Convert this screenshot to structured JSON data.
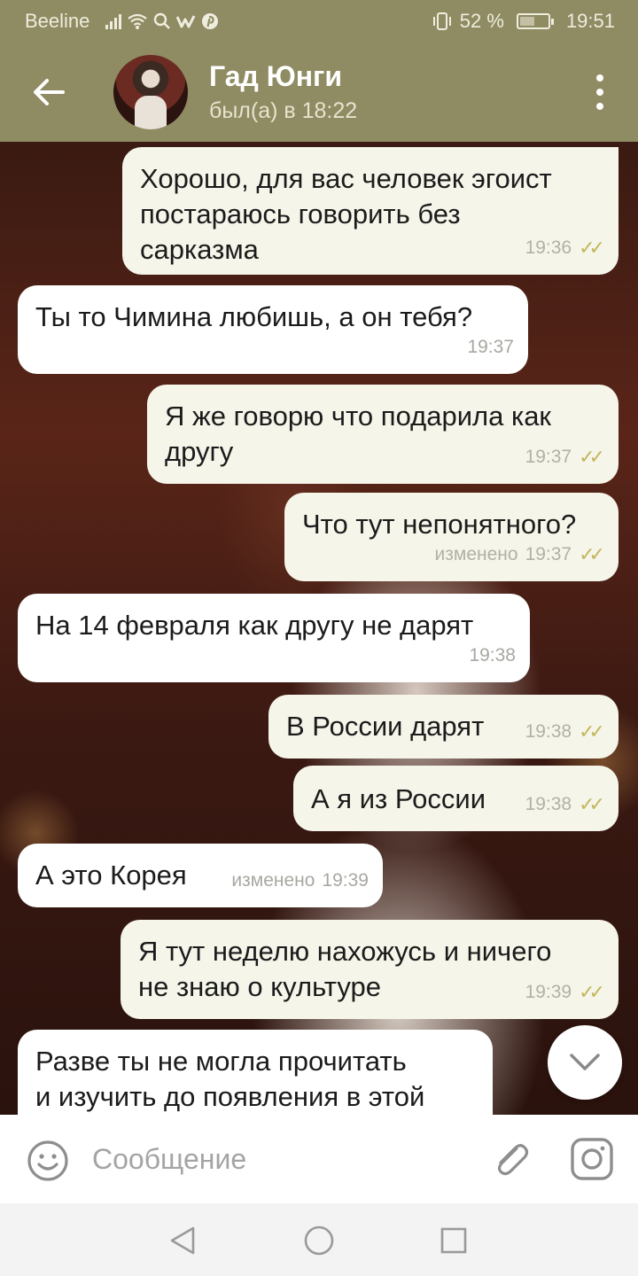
{
  "status_bar": {
    "carrier": "Beeline",
    "battery": "52 %",
    "time": "19:51",
    "battery_level": 0.52
  },
  "header": {
    "contact_name": "Гад Юнги",
    "contact_status": "был(а) в 18:22",
    "icons": [
      "back-arrow-icon",
      "avatar",
      "more-vert-icon"
    ]
  },
  "messages": [
    {
      "dir": "out",
      "text": "Хорошо, для вас человек эгоист\nпостараюсь говорить без\nсарказма",
      "time": "19:36",
      "edited": "",
      "read": true
    },
    {
      "dir": "in",
      "text": "Ты то Чимина любишь, а он тебя?",
      "time": "19:37",
      "edited": "",
      "read": false
    },
    {
      "dir": "out",
      "text": "Я же говорю что подарила как\nдругу",
      "time": "19:37",
      "edited": "",
      "read": true
    },
    {
      "dir": "out",
      "text": "Что тут непонятного?",
      "time": "19:37",
      "edited": "изменено",
      "read": true
    },
    {
      "dir": "in",
      "text": "На 14 февраля как другу не дарят",
      "time": "19:38",
      "edited": "",
      "read": false
    },
    {
      "dir": "out",
      "text": "В России дарят",
      "time": "19:38",
      "edited": "",
      "read": true
    },
    {
      "dir": "out",
      "text": "А я из России",
      "time": "19:38",
      "edited": "",
      "read": true
    },
    {
      "dir": "in",
      "text": "А это Корея",
      "time": "19:39",
      "edited": "изменено",
      "read": false
    },
    {
      "dir": "out",
      "text": "Я тут неделю нахожусь и ничего\nне знаю о культуре",
      "time": "19:39",
      "edited": "",
      "read": true
    },
    {
      "dir": "in",
      "text": "Разве ты не могла прочитать\nи изучить до появления в этой",
      "time": "",
      "edited": "",
      "read": false
    }
  ],
  "input": {
    "placeholder": "Сообщение",
    "value": ""
  },
  "colors": {
    "header_bg": "#8f8b62",
    "bubble_in": "#ffffff",
    "bubble_out": "#f6f5ea",
    "read_check": "#c2b75c"
  }
}
